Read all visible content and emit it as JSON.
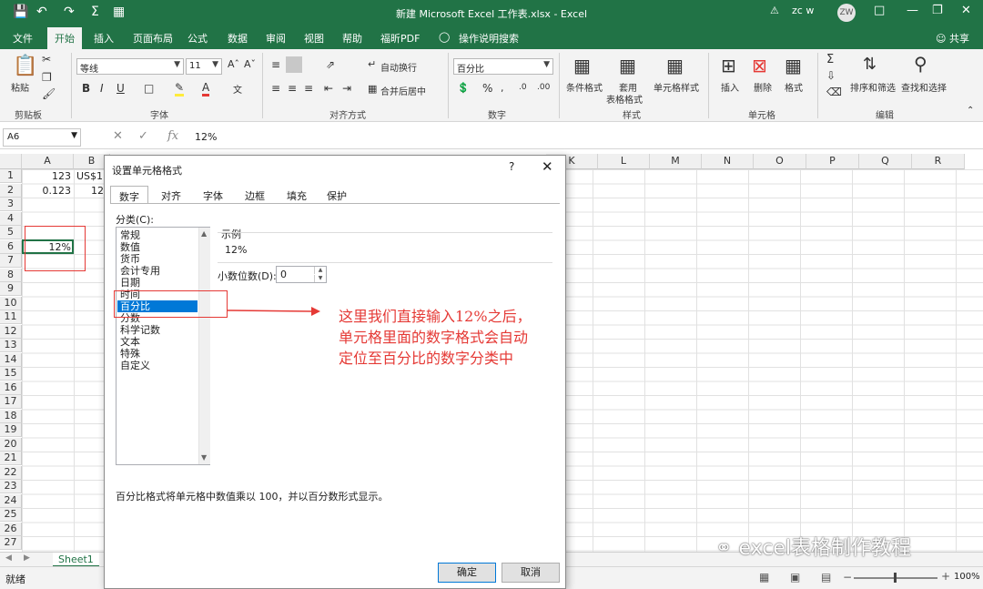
{
  "titlebar": {
    "title": "新建 Microsoft Excel 工作表.xlsx  -  Excel",
    "user": "zc w",
    "avatar": "ZW"
  },
  "menubar": {
    "tabs": [
      "文件",
      "开始",
      "插入",
      "页面布局",
      "公式",
      "数据",
      "审阅",
      "视图",
      "帮助",
      "福昕PDF"
    ],
    "active": "开始",
    "tell_me": "操作说明搜索",
    "share": "共享"
  },
  "ribbon": {
    "clipboard": {
      "paste": "粘贴",
      "label": "剪贴板"
    },
    "font": {
      "name": "等线",
      "size": "11",
      "label": "字体"
    },
    "alignment": {
      "wrap": "自动换行",
      "merge": "合并后居中",
      "label": "对齐方式"
    },
    "number": {
      "format": "百分比",
      "label": "数字"
    },
    "styles": {
      "conditional": "条件格式",
      "table_line1": "套用",
      "table_line2": "表格格式",
      "cell_styles": "单元格样式",
      "label": "样式"
    },
    "cells": {
      "insert": "插入",
      "delete": "删除",
      "format": "格式",
      "label": "单元格"
    },
    "editing": {
      "sort": "排序和筛选",
      "find": "查找和选择",
      "label": "编辑"
    }
  },
  "formula_bar": {
    "name_box": "A6",
    "fx": "fx",
    "value": "12%"
  },
  "grid": {
    "columns": [
      "A",
      "B",
      "K",
      "L",
      "M",
      "N",
      "O",
      "P",
      "Q",
      "R"
    ],
    "rows": [
      "1",
      "2",
      "3",
      "4",
      "5",
      "6",
      "7",
      "8",
      "9",
      "10",
      "11",
      "12",
      "13",
      "14",
      "15",
      "16",
      "17",
      "18",
      "19",
      "20",
      "21",
      "22",
      "23",
      "24",
      "25",
      "26",
      "27"
    ],
    "cells": {
      "A1": "123",
      "B1": "US$1",
      "A2": "0.123",
      "B2": "12",
      "A6": "12%"
    }
  },
  "sheet": {
    "tab": "Sheet1",
    "status": "就绪",
    "zoom": "100%"
  },
  "dialog": {
    "title": "设置单元格格式",
    "tabs": [
      "数字",
      "对齐",
      "字体",
      "边框",
      "填充",
      "保护"
    ],
    "category_label": "分类(C):",
    "categories": [
      "常规",
      "数值",
      "货币",
      "会计专用",
      "日期",
      "时间",
      "百分比",
      "分数",
      "科学记数",
      "文本",
      "特殊",
      "自定义"
    ],
    "selected_category": "百分比",
    "sample_label": "示例",
    "sample_value": "12%",
    "decimal_label": "小数位数(D):",
    "decimal_value": "0",
    "description": "百分比格式将单元格中数值乘以 100，并以百分数形式显示。",
    "ok": "确定",
    "cancel": "取消"
  },
  "annotation": {
    "line1": "这里我们直接输入12%之后，",
    "line2": "单元格里面的数字格式会自动",
    "line3": "定位至百分比的数字分类中"
  },
  "watermark": "excel表格制作教程",
  "colors": {
    "excel_green": "#217346",
    "highlight_red": "#e53935",
    "selection_blue": "#0078d7"
  }
}
